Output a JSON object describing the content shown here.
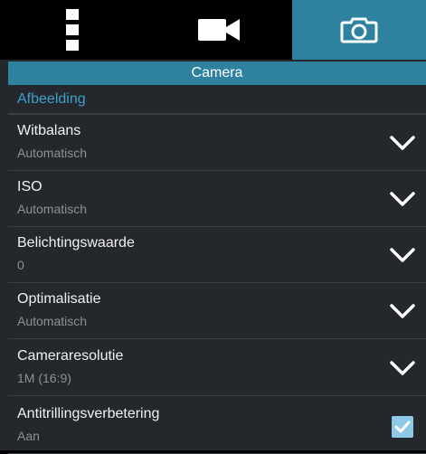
{
  "tabs": [
    {
      "icon": "overflow-menu-icon"
    },
    {
      "icon": "video-camera-icon"
    },
    {
      "icon": "camera-icon",
      "selected": true
    }
  ],
  "header": {
    "title": "Camera"
  },
  "section": {
    "title": "Afbeelding"
  },
  "settings": [
    {
      "label": "Witbalans",
      "value": "Automatisch",
      "control": "dropdown"
    },
    {
      "label": "ISO",
      "value": "Automatisch",
      "control": "dropdown"
    },
    {
      "label": "Belichtingswaarde",
      "value": "0",
      "control": "dropdown"
    },
    {
      "label": "Optimalisatie",
      "value": "Automatisch",
      "control": "dropdown"
    },
    {
      "label": "Cameraresolutie",
      "value": "1M (16:9)",
      "control": "dropdown"
    },
    {
      "label": "Antitrillingsverbetering",
      "value": "Aan",
      "control": "checkbox",
      "checked": true
    }
  ],
  "colors": {
    "accent": "#2e82a0",
    "section_title": "#3da1cc",
    "background": "#24272c",
    "checkbox": "#8fc7e6"
  }
}
